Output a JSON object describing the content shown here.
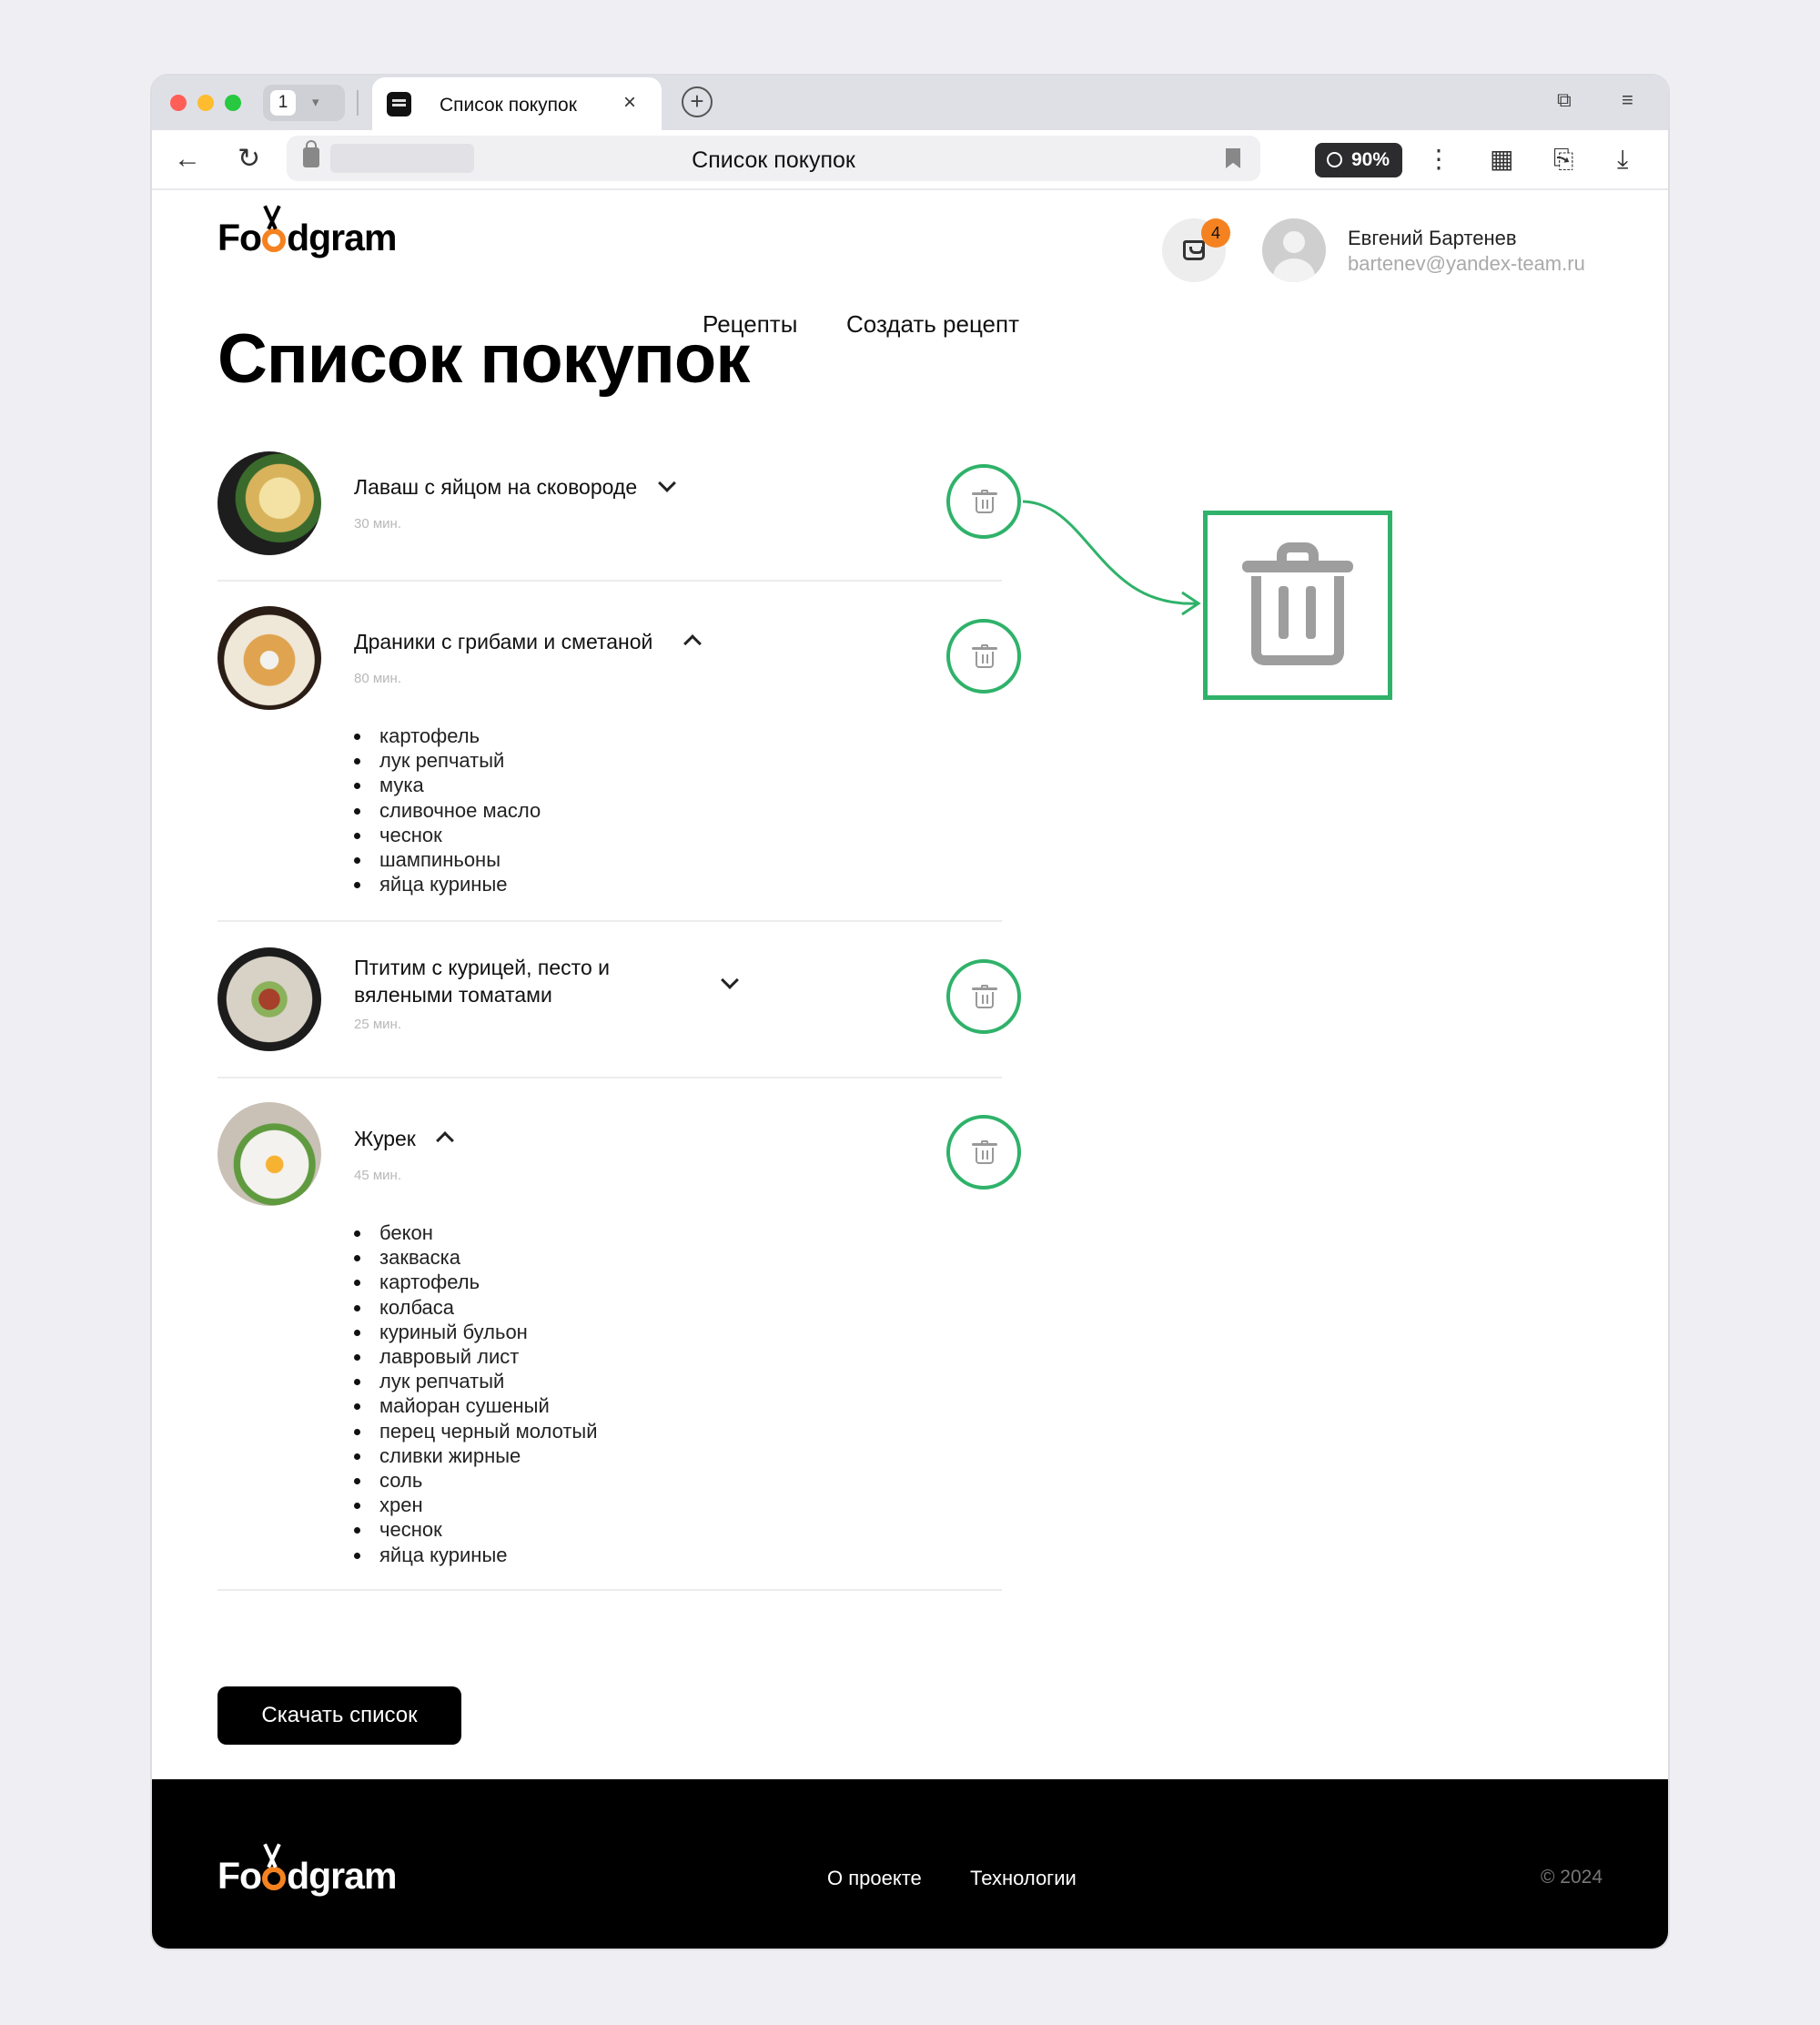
{
  "browser": {
    "tab_count": "1",
    "tab_title": "Список покупок",
    "tab_close": "×",
    "new_tab": "+",
    "address_title": "Список покупок",
    "zoom": "90%"
  },
  "header": {
    "logo_left": "Fo",
    "logo_right": "dgram",
    "nav": [
      "Рецепты",
      "Создать рецепт"
    ],
    "cart_count": "4",
    "user_name": "Евгений Бартенев",
    "user_email": "bartenev@yandex-team.ru"
  },
  "page_title": "Список покупок",
  "recipes": [
    {
      "title": "Лаваш с яйцом на сковороде",
      "time": "30 мин.",
      "expanded": false,
      "ingredients": []
    },
    {
      "title": "Драники с грибами и сметаной",
      "time": "80 мин.",
      "expanded": true,
      "ingredients": [
        "картофель",
        "лук репчатый",
        "мука",
        "сливочное масло",
        "чеснок",
        "шампиньоны",
        "яйца куриные"
      ]
    },
    {
      "title_line1": "Птитим с курицей, песто и",
      "title_line2": "вялеными томатами",
      "time": "25 мин.",
      "expanded": false,
      "ingredients": []
    },
    {
      "title": "Журек",
      "time": "45 мин.",
      "expanded": true,
      "ingredients": [
        "бекон",
        "закваска",
        "картофель",
        "колбаса",
        "куриный бульон",
        "лавровый лист",
        "лук репчатый",
        "майоран сушеный",
        "перец черный молотый",
        "сливки жирные",
        "соль",
        "хрен",
        "чеснок",
        "яйца куриные"
      ]
    }
  ],
  "download_button": "Скачать список",
  "footer": {
    "logo_left": "Fo",
    "logo_right": "dgram",
    "links": [
      "О проекте",
      "Технологии"
    ],
    "copyright": "© 2024"
  },
  "colors": {
    "accent": "#f58220",
    "annotation": "#2fb26a",
    "footer_bg": "#000000"
  },
  "icons": [
    "back-icon",
    "reload-icon",
    "lock-icon",
    "bookmark-icon",
    "search-icon",
    "more-icon",
    "qr-icon",
    "translate-icon",
    "download-icon",
    "cart-icon",
    "trash-icon",
    "chevron-down-icon",
    "chevron-up-icon"
  ]
}
